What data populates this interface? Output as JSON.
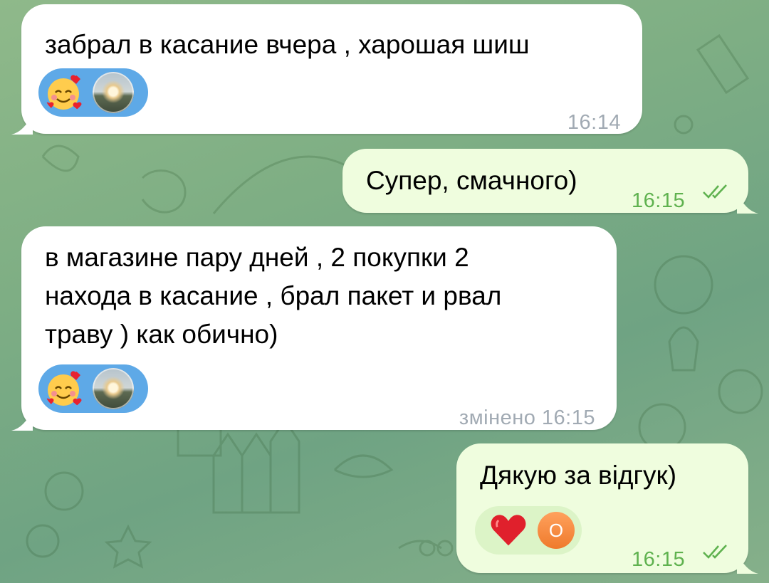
{
  "chat": {
    "messages": [
      {
        "direction": "incoming",
        "text": "забрал в касание вчера , харошая шиш",
        "time": "16:14",
        "reactions": [
          "smiling-face-with-hearts",
          "profile-photo"
        ]
      },
      {
        "direction": "outgoing",
        "text": "Супер, смачного)",
        "time": "16:15",
        "status": "read"
      },
      {
        "direction": "incoming",
        "text": "в магазине пару дней , 2 покупки 2\nнахода в касание , брал пакет и рвал\nтраву ) как обично)",
        "time": "змінено 16:15",
        "reactions": [
          "smiling-face-with-hearts",
          "profile-photo"
        ]
      },
      {
        "direction": "outgoing",
        "text": "Дякую за відгук)",
        "time": "16:15",
        "status": "read",
        "reactions": [
          "red-heart",
          "avatar-letter"
        ],
        "avatar_letter": "О"
      }
    ]
  },
  "colors": {
    "incoming_bubble": "#ffffff",
    "outgoing_bubble": "#effdde",
    "incoming_reaction_pill": "#5ea9e7",
    "outgoing_reaction_pill": "#dcf4c7",
    "outgoing_time": "#5fb24f",
    "incoming_time": "#a1aab3",
    "wallpaper": "#7eae84"
  }
}
